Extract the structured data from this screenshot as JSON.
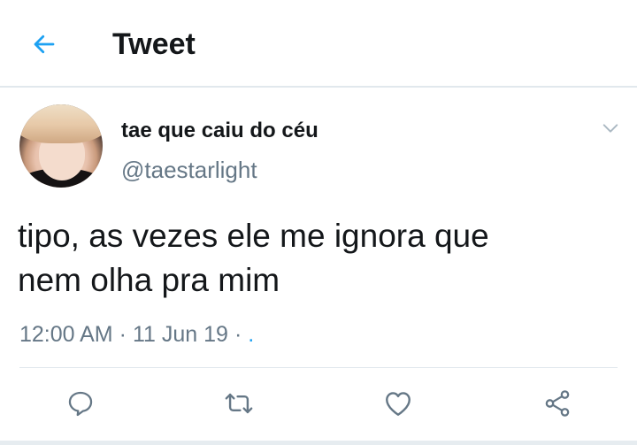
{
  "header": {
    "back_icon": "arrow-left-icon",
    "title": "Tweet"
  },
  "tweet": {
    "author": {
      "display_name": "tae que caiu do céu",
      "handle": "@taestarlight",
      "avatar": "profile-photo"
    },
    "text_lines": [
      "tipo, as vezes ele me ignora que",
      "nem olha pra mim"
    ],
    "time": "12:00 AM",
    "date": "11 Jun 19",
    "separator": "·",
    "source": "."
  },
  "actions": {
    "reply_icon": "reply-icon",
    "retweet_icon": "retweet-icon",
    "like_icon": "heart-icon",
    "share_icon": "share-icon"
  },
  "colors": {
    "accent": "#1da1f2",
    "text_primary": "#14171a",
    "text_secondary": "#657786",
    "divider": "#e1e8ed"
  }
}
